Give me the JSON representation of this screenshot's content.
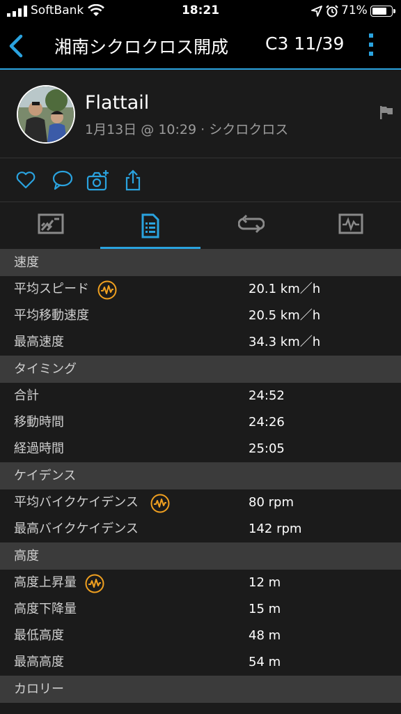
{
  "status_bar": {
    "carrier": "SoftBank",
    "time": "18:21",
    "battery": "71%"
  },
  "header": {
    "title": "湘南シクロクロス開成",
    "count": "C3 11/39"
  },
  "profile": {
    "name": "Flattail",
    "subtitle": "1月13日 @ 10:29 · シクロクロス"
  },
  "colors": {
    "accent": "#2aa3df",
    "badge": "#f0a020",
    "section_bg": "#3b3b3b",
    "row_bg": "#1b1b1b"
  },
  "social_icons": [
    "heart-icon",
    "comment-icon",
    "camera-add-icon",
    "share-icon"
  ],
  "tabs": [
    "map-tab",
    "stats-tab",
    "laps-tab",
    "charts-tab"
  ],
  "sections": {
    "speed": {
      "heading": "速度",
      "rows": [
        {
          "label": "平均スピード",
          "value": "20.1 km／h"
        },
        {
          "label": "平均移動速度",
          "value": "20.5 km／h"
        },
        {
          "label": "最高速度",
          "value": "34.3 km／h"
        }
      ]
    },
    "timing": {
      "heading": "タイミング",
      "rows": [
        {
          "label": "合計",
          "value": "24:52"
        },
        {
          "label": "移動時間",
          "value": "24:26"
        },
        {
          "label": "経過時間",
          "value": "25:05"
        }
      ]
    },
    "cadence": {
      "heading": "ケイデンス",
      "rows": [
        {
          "label": "平均バイクケイデンス",
          "value": "80 rpm"
        },
        {
          "label": "最高バイクケイデンス",
          "value": "142 rpm"
        }
      ]
    },
    "elevation": {
      "heading": "高度",
      "rows": [
        {
          "label": "高度上昇量",
          "value": "12 m"
        },
        {
          "label": "高度下降量",
          "value": "15 m"
        },
        {
          "label": "最低高度",
          "value": "48 m"
        },
        {
          "label": "最高高度",
          "value": "54 m"
        }
      ]
    },
    "calories": {
      "heading": "カロリー"
    }
  }
}
